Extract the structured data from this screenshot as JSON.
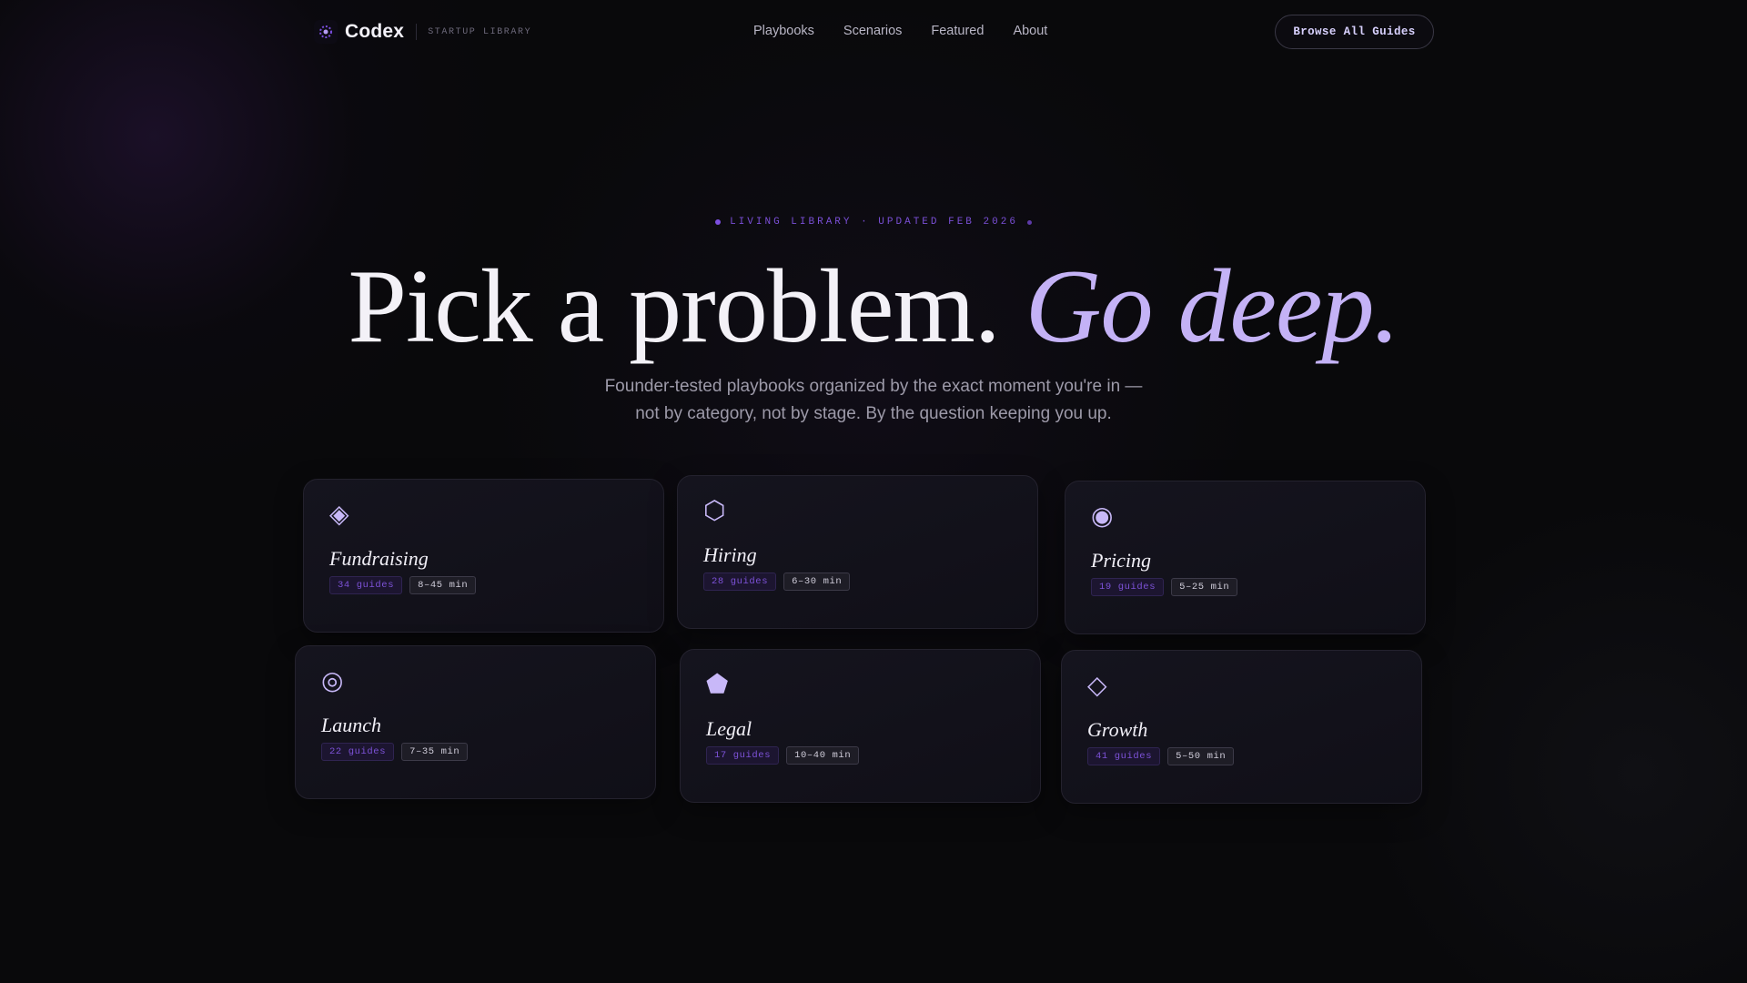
{
  "nav": {
    "brand": "Codex",
    "tagline": "STARTUP LIBRARY",
    "links": [
      "Playbooks",
      "Scenarios",
      "Featured",
      "About"
    ],
    "cta": "Browse All Guides"
  },
  "hero": {
    "eyebrow": "LIVING LIBRARY · UPDATED FEB 2026",
    "headline_main": "Pick a problem.",
    "headline_accent": "Go deep.",
    "subtitle_line1": "Founder-tested playbooks organized by the exact moment you're in —",
    "subtitle_line2": "not by category, not by stage. By the question keeping you up."
  },
  "cards": [
    {
      "title": "Fundraising",
      "icon": "diamond-filled-icon",
      "glyph": "◈",
      "guides": "34 guides",
      "time": "8–45 min"
    },
    {
      "title": "Hiring",
      "icon": "hexagon-icon",
      "glyph": "⬡",
      "guides": "28 guides",
      "time": "6–30 min"
    },
    {
      "title": "Pricing",
      "icon": "target-circle-icon",
      "glyph": "◉",
      "guides": "19 guides",
      "time": "5–25 min"
    },
    {
      "title": "Launch",
      "icon": "bullseye-icon",
      "glyph": "◎",
      "guides": "22 guides",
      "time": "7–35 min"
    },
    {
      "title": "Legal",
      "icon": "pentagon-icon",
      "glyph": "⬟",
      "guides": "17 guides",
      "time": "10–40 min"
    },
    {
      "title": "Growth",
      "icon": "diamond-outline-icon",
      "glyph": "◇",
      "guides": "41 guides",
      "time": "5–50 min"
    }
  ],
  "colors": {
    "accent": "#c4b2f6",
    "accent_strong": "#7c4ee0",
    "background": "#09090b",
    "card": "#14131c"
  }
}
